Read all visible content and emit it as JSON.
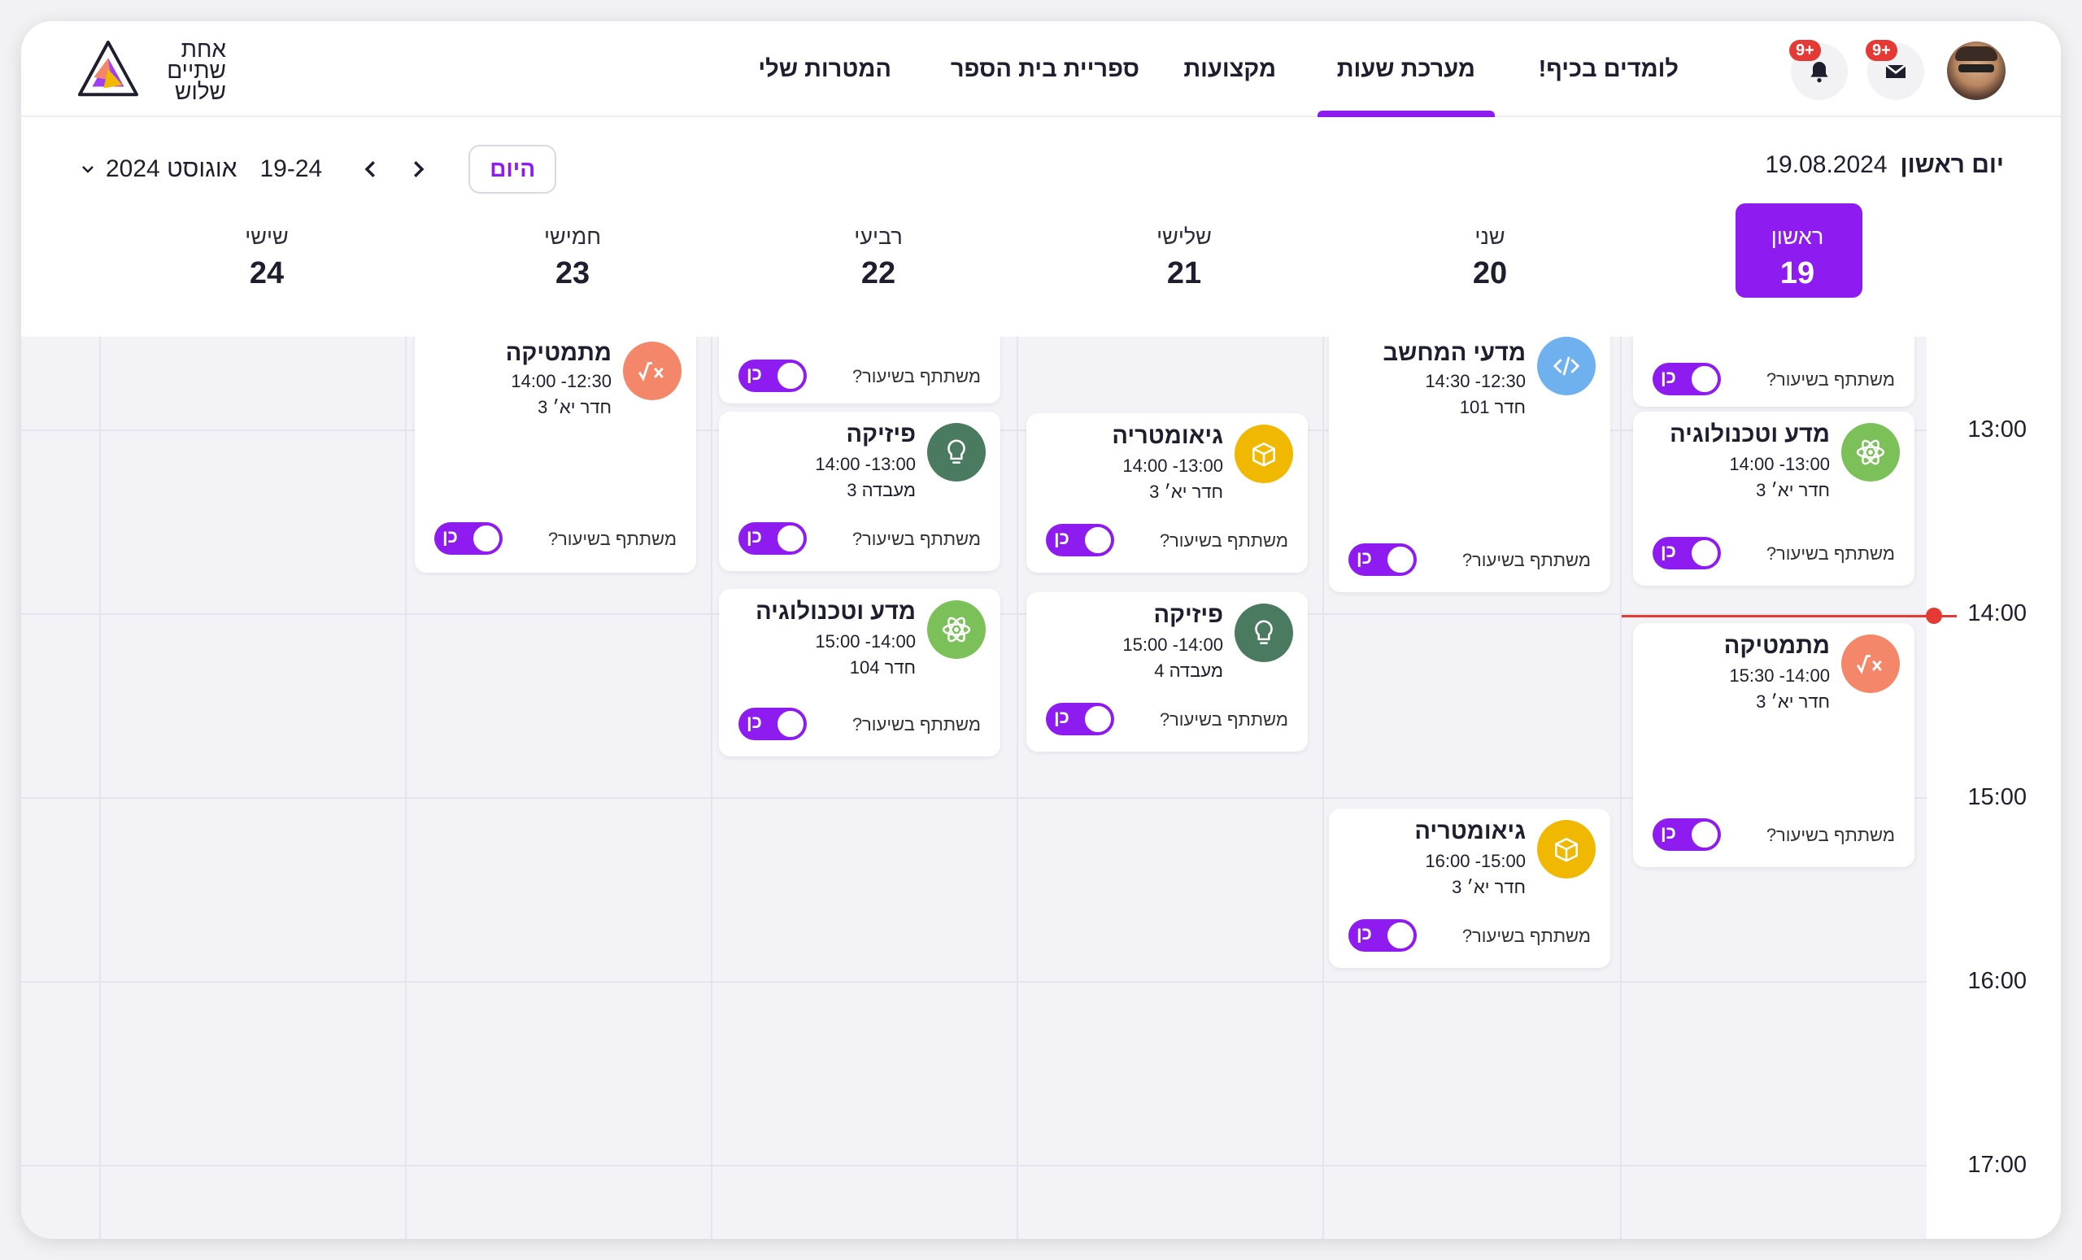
{
  "logo": {
    "lines": [
      "אחת",
      "שתיים",
      "שלוש"
    ]
  },
  "nav": {
    "items": [
      "לומדים בכיף!",
      "מערכת שעות",
      "מקצועות",
      "ספריית בית הספר",
      "המטרות שלי"
    ],
    "active": "מערכת שעות"
  },
  "notifications": {
    "bell_badge": "9+",
    "mail_badge": "9+"
  },
  "toolbar": {
    "current_day": "יום ראשון",
    "current_date": "19.08.2024",
    "today_label": "היום",
    "range": "19-24",
    "month": "אוגוסט 2024"
  },
  "days": [
    {
      "name": "ראשון",
      "num": "19",
      "selected": true
    },
    {
      "name": "שני",
      "num": "20"
    },
    {
      "name": "שלישי",
      "num": "21"
    },
    {
      "name": "רביעי",
      "num": "22"
    },
    {
      "name": "חמישי",
      "num": "23"
    },
    {
      "name": "שישי",
      "num": "24"
    }
  ],
  "times": [
    "13:00",
    "14:00",
    "15:00",
    "16:00",
    "17:00"
  ],
  "participate_q": "משתתף בשיעור?",
  "toggle_label": "כן",
  "lessons": [
    {
      "title": "מדע וטכנולוגיה",
      "time": "13:00- 14:00",
      "room": "חדר יא׳ 3",
      "icon": "atom-icon",
      "color": "#7cc05a"
    },
    {
      "title": "מתמטיקה",
      "time": "14:00- 15:30",
      "room": "חדר יא׳ 3",
      "icon": "math-icon",
      "color": "#f4876a"
    },
    {
      "title": "מדעי המחשב",
      "time": "12:30- 14:30",
      "room": "חדר 101",
      "icon": "code-icon",
      "color": "#6fb0ef"
    },
    {
      "title": "גיאומטריה",
      "time": "15:00- 16:00",
      "room": "חדר יא׳ 3",
      "icon": "cube-icon",
      "color": "#f0b800"
    },
    {
      "title": "גיאומטריה",
      "time": "13:00- 14:00",
      "room": "חדר יא׳ 3",
      "icon": "cube-icon",
      "color": "#f0b800"
    },
    {
      "title": "פיזיקה",
      "time": "14:00- 15:00",
      "room": "מעבדה 4",
      "icon": "bulb-icon",
      "color": "#4a7a5f"
    },
    {
      "title": "פיזיקה",
      "time": "13:00- 14:00",
      "room": "מעבדה 3",
      "icon": "bulb-icon",
      "color": "#4a7a5f"
    },
    {
      "title": "מדע וטכנולוגיה",
      "time": "14:00- 15:00",
      "room": "חדר 104",
      "icon": "atom-icon",
      "color": "#7cc05a"
    },
    {
      "title": "מתמטיקה",
      "time": "12:30- 14:00",
      "room": "חדר יא׳ 3",
      "icon": "math-icon",
      "color": "#f4876a"
    }
  ]
}
